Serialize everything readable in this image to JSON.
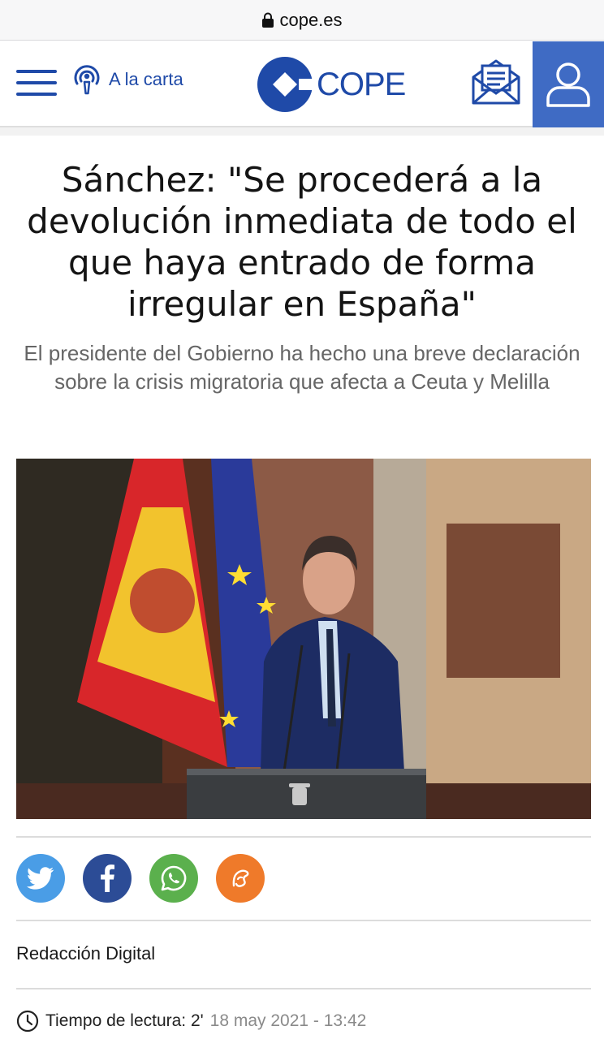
{
  "browser": {
    "url": "cope.es"
  },
  "header": {
    "menu_icon": "hamburger-icon",
    "carta_label": "A la carta",
    "carta_icon": "podcast-icon",
    "logo_text": "COPE",
    "newsletter_icon": "mail-icon",
    "account_icon": "user-icon"
  },
  "colors": {
    "brand_blue": "#1f4aa8",
    "account_bg": "#3f6bc4",
    "twitter": "#4a9de6",
    "facebook": "#2c4c96",
    "whatsapp": "#5bb04d",
    "rss": "#ef7a2a"
  },
  "article": {
    "headline": "Sánchez: \"Se procederá a la devolución inmediata de todo el que haya entrado de forma irregular en España\"",
    "subheadline": "El presidente del Gobierno ha hecho una breve declaración sobre la crisis migratoria que afecta a Ceuta y Melilla",
    "author": "Redacción Digital",
    "read_time_label": "Tiempo de lectura: 2'",
    "date": "18 may 2021 - 13:42"
  },
  "share": [
    {
      "network": "twitter",
      "icon": "twitter-icon"
    },
    {
      "network": "facebook",
      "icon": "facebook-icon"
    },
    {
      "network": "whatsapp",
      "icon": "whatsapp-icon"
    },
    {
      "network": "rss",
      "icon": "rss-icon"
    }
  ]
}
